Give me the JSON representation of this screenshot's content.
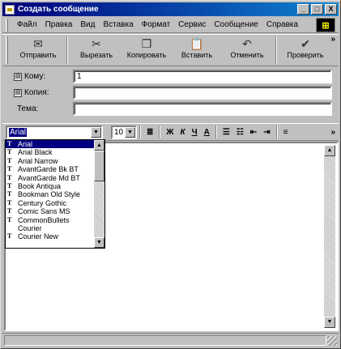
{
  "window": {
    "title": "Создать сообщение",
    "min_label": "_",
    "max_label": "□",
    "close_label": "X"
  },
  "menubar": {
    "items": [
      "Файл",
      "Правка",
      "Вид",
      "Вставка",
      "Формат",
      "Сервис",
      "Сообщение",
      "Справка"
    ]
  },
  "toolbar": {
    "send": {
      "label": "Отправить",
      "icon": "send-icon"
    },
    "cut": {
      "label": "Вырезать",
      "icon": "scissors-icon"
    },
    "copy": {
      "label": "Копировать",
      "icon": "copy-icon"
    },
    "paste": {
      "label": "Вставить",
      "icon": "paste-icon"
    },
    "undo": {
      "label": "Отменить",
      "icon": "undo-icon"
    },
    "check": {
      "label": "Проверить",
      "icon": "check-names-icon"
    },
    "more": "»"
  },
  "address": {
    "to_label": "Кому:",
    "to_value": "1",
    "cc_label": "Копия:",
    "cc_value": "",
    "subject_label": "Тема:",
    "subject_value": ""
  },
  "format": {
    "font_value": "Arial",
    "size_value": "10",
    "bold": "Ж",
    "italic": "К",
    "underline": "Ч",
    "color": "A",
    "more": "»"
  },
  "font_list": {
    "selected": "Arial",
    "items": [
      {
        "name": "Arial",
        "truetype": true
      },
      {
        "name": "Arial Black",
        "truetype": true
      },
      {
        "name": "Arial Narrow",
        "truetype": true
      },
      {
        "name": "AvantGarde Bk BT",
        "truetype": true
      },
      {
        "name": "AvantGarde Md BT",
        "truetype": true
      },
      {
        "name": "Book Antiqua",
        "truetype": true
      },
      {
        "name": "Bookman Old Style",
        "truetype": true
      },
      {
        "name": "Century Gothic",
        "truetype": true
      },
      {
        "name": "Comic Sans MS",
        "truetype": true
      },
      {
        "name": "CommonBullets",
        "truetype": true
      },
      {
        "name": "Courier",
        "truetype": false
      },
      {
        "name": "Courier New",
        "truetype": true
      }
    ]
  },
  "colors": {
    "titlebar_start": "#00007b",
    "titlebar_end": "#1084d0",
    "selection": "#000080"
  }
}
